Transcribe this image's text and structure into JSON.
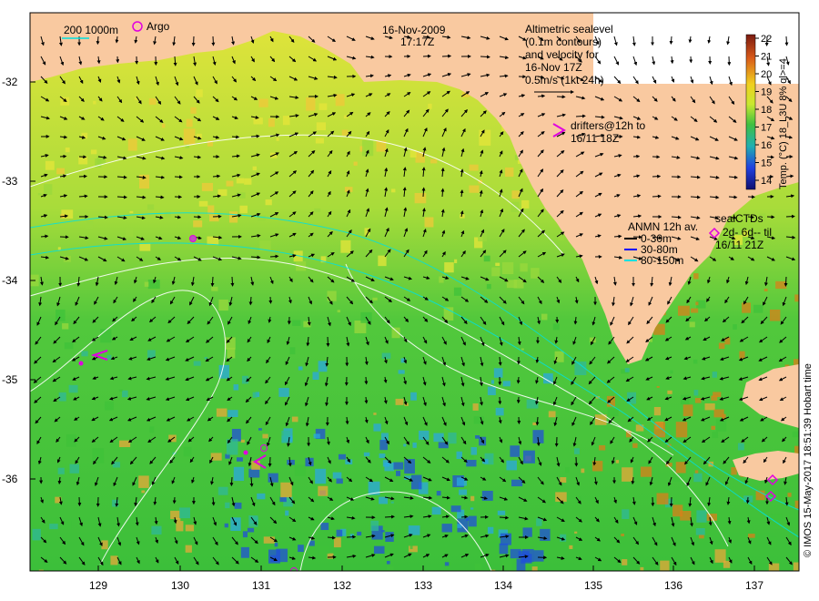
{
  "title": {
    "date": "16-Nov-2009",
    "time": "17:17Z"
  },
  "legend_top_left": {
    "contour_label": "200  1000m",
    "argo_label": "Argo"
  },
  "altimetry_note": {
    "lines": [
      "Altimetric sealevel",
      "(0.1m contours)",
      "and velocity for",
      "16-Nov 17Z",
      "0.5m/s (1kt 24h)"
    ]
  },
  "drifters_note": {
    "lines": [
      "drifters@12h to",
      "16/11 18Z"
    ]
  },
  "anmn_legend": {
    "title": "ANMN 12h av.",
    "items": [
      {
        "label": "0-30m",
        "color": "#000000"
      },
      {
        "label": "30-80m",
        "color": "#0000ff"
      },
      {
        "label": "80-150m",
        "color": "#00e0e0"
      }
    ]
  },
  "seal_legend": {
    "title": "sealCTDs",
    "line1": "2d-  6d-- til",
    "line2": "16/11 21Z"
  },
  "colorbar": {
    "title": "Temp. (°C) 18_L3U 8% ql>=4",
    "ticks": [
      "22",
      "21",
      "20",
      "19",
      "18",
      "17",
      "16",
      "15",
      "14"
    ]
  },
  "credit": "© IMOS 15-May-2017 18:51:39 Hobart time",
  "axes": {
    "lat_ticks": [
      "-32",
      "-33",
      "-34",
      "-35",
      "-36"
    ],
    "lon_ticks": [
      "129",
      "130",
      "131",
      "132",
      "133",
      "134",
      "135",
      "136",
      "137"
    ]
  },
  "colors": {
    "land": "#f9c9a0",
    "sea_warm": "#e8e83a",
    "sea_mid": "#4fcc3c",
    "sea_cool": "#2ab0e0",
    "argo": "#e000e0"
  }
}
